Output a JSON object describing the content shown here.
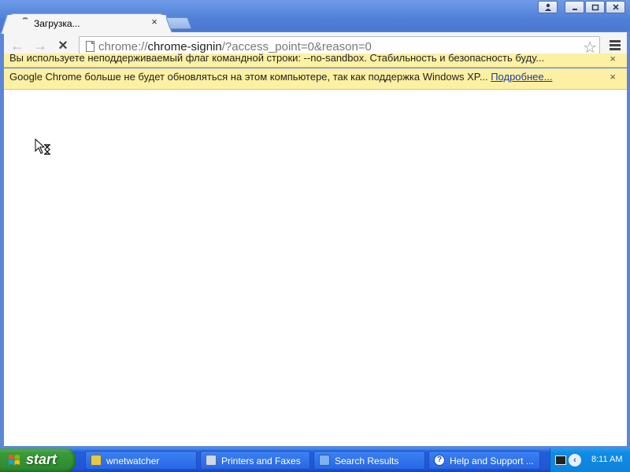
{
  "tab": {
    "title": "Загрузка...",
    "close": "×"
  },
  "toolbar": {
    "back": "←",
    "forward": "→",
    "stop": "×",
    "url_scheme": "chrome://",
    "url_host": "chrome-signin",
    "url_rest": "/?access_point=0&reason=0",
    "bookmark_star": "☆"
  },
  "infobars": [
    {
      "text": "Вы используете неподдерживаемый флаг командной строки: --no-sandbox. Стабильность и безопасность буду...",
      "close": "×"
    },
    {
      "text": "Google Chrome больше не будет обновляться на этом компьютере, так как поддержка Windows XP...",
      "link": "Подробнее...",
      "close": "×"
    }
  ],
  "taskbar": {
    "start_label": "start",
    "tasks": [
      {
        "label": "wnetwatcher"
      },
      {
        "label": "Printers and Faxes"
      },
      {
        "label": "Search Results"
      },
      {
        "label": "Help and Support ..."
      }
    ],
    "tray_arrow": "‹",
    "clock": "8:11 AM"
  }
}
